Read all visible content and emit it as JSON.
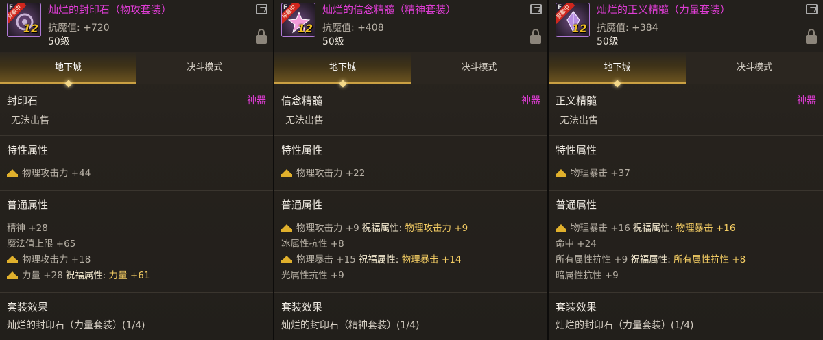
{
  "panels": [
    {
      "name": "灿烂的封印石（物攻套装）",
      "resist": "抗魔值: +720",
      "level": "50级",
      "icon_badge": "穿戴中",
      "icon_rank": "F",
      "icon_grade": "12",
      "tabs": [
        "地下城",
        "决斗模式"
      ],
      "type": "封印石",
      "rarity": "神器",
      "nosell": "无法出售",
      "special_title": "特性属性",
      "special": [
        {
          "crown": true,
          "text": "物理攻击力 +44",
          "bless": ""
        }
      ],
      "normal_title": "普通属性",
      "normal": [
        {
          "crown": false,
          "text": "精神 +28",
          "bless": ""
        },
        {
          "crown": false,
          "text": "魔法值上限 +65",
          "bless": ""
        },
        {
          "crown": true,
          "text": "物理攻击力 +18",
          "bless": ""
        },
        {
          "crown": true,
          "text": "力量 +28",
          "bless": "力量 +61"
        }
      ],
      "set_title": "套装效果",
      "set_name": "灿烂的封印石（力量套装）(1/4)"
    },
    {
      "name": "灿烂的信念精髓（精神套装）",
      "resist": "抗魔值: +408",
      "level": "50级",
      "icon_badge": "穿戴中",
      "icon_rank": "F",
      "icon_grade": "12",
      "tabs": [
        "地下城",
        "决斗模式"
      ],
      "type": "信念精髓",
      "rarity": "神器",
      "nosell": "无法出售",
      "special_title": "特性属性",
      "special": [
        {
          "crown": true,
          "text": "物理攻击力 +22",
          "bless": ""
        }
      ],
      "normal_title": "普通属性",
      "normal": [
        {
          "crown": true,
          "text": "物理攻击力 +9",
          "bless": "物理攻击力 +9"
        },
        {
          "crown": false,
          "text": "冰属性抗性 +8",
          "bless": ""
        },
        {
          "crown": true,
          "text": "物理暴击 +15",
          "bless": "物理暴击 +14"
        },
        {
          "crown": false,
          "text": "光属性抗性 +9",
          "bless": ""
        }
      ],
      "set_title": "套装效果",
      "set_name": "灿烂的封印石（精神套装）(1/4)"
    },
    {
      "name": "灿烂的正义精髓（力量套装）",
      "resist": "抗魔值: +384",
      "level": "50级",
      "icon_badge": "穿戴中",
      "icon_rank": "F",
      "icon_grade": "12",
      "tabs": [
        "地下城",
        "决斗模式"
      ],
      "type": "正义精髓",
      "rarity": "神器",
      "nosell": "无法出售",
      "special_title": "特性属性",
      "special": [
        {
          "crown": true,
          "text": "物理暴击 +37",
          "bless": ""
        }
      ],
      "normal_title": "普通属性",
      "normal": [
        {
          "crown": true,
          "text": "物理暴击 +16",
          "bless": "物理暴击 +16"
        },
        {
          "crown": false,
          "text": "命中 +24",
          "bless": ""
        },
        {
          "crown": false,
          "text": "所有属性抗性 +9",
          "bless": "所有属性抗性 +8"
        },
        {
          "crown": false,
          "text": "暗属性抗性 +9",
          "bless": ""
        }
      ],
      "set_title": "套装效果",
      "set_name": "灿烂的封印石（力量套装）(1/4)"
    }
  ],
  "bless_label": "祝福属性:",
  "colors": {
    "rarity": "#e03dd6",
    "bless": "#f3cc63",
    "crown": "#e0b02c",
    "tab_active": "#caa043"
  }
}
